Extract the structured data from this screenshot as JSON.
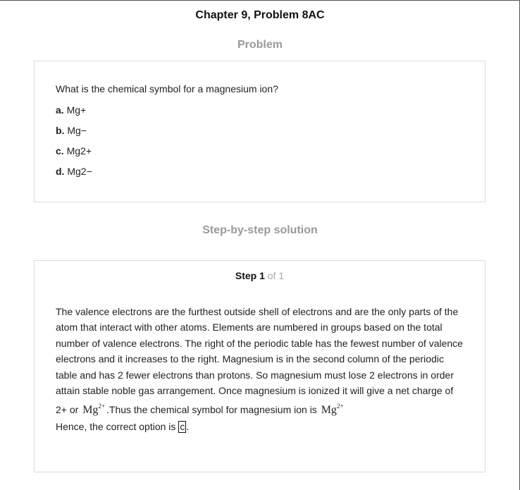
{
  "header": {
    "title": "Chapter 9, Problem 8AC"
  },
  "problem": {
    "heading": "Problem",
    "question": "What is the chemical symbol for a magnesium ion?",
    "options": [
      {
        "letter": "a.",
        "text": "Mg+"
      },
      {
        "letter": "b.",
        "text": "Mg−"
      },
      {
        "letter": "c.",
        "text": "Mg2+"
      },
      {
        "letter": "d.",
        "text": "Mg2−"
      }
    ]
  },
  "solution": {
    "heading": "Step-by-step solution",
    "step_label": "Step 1",
    "step_of": "of 1",
    "explanation_main": "The valence electrons are the furthest outside shell of electrons and are the only parts of the atom that interact with other atoms. Elements are numbered in groups based on the total number of valence electrons. The right of the periodic table has the fewest number of valence electrons and it increases to the right. Magnesium is in the second column of the periodic table and has 2 fewer electrons than protons. So magnesium must lose 2 electrons in order attain stable noble gas arrangement. Once magnesium is ionized it will give a net charge of 2+ or",
    "formula_base": "Mg",
    "formula_charge": "2+",
    "explanation_mid": ".Thus the chemical symbol for magnesium ion is",
    "answer_prefix": "Hence, the correct option is",
    "answer_value": "c",
    "answer_suffix": "."
  }
}
